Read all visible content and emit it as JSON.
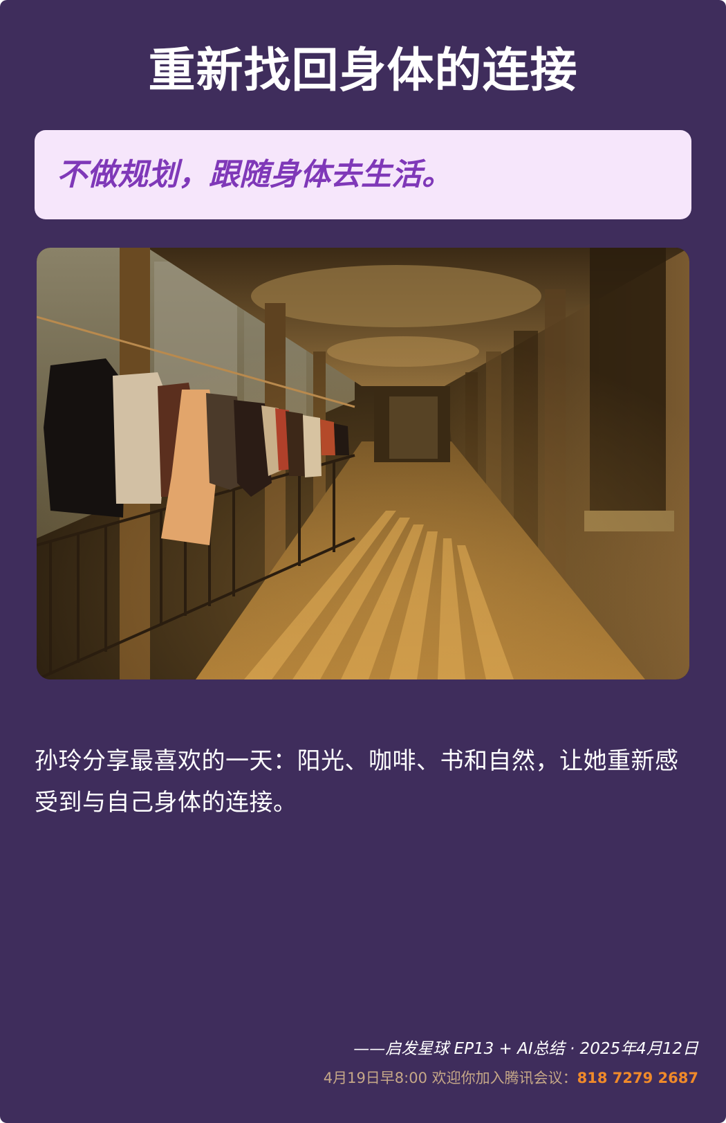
{
  "title": "重新找回身体的连接",
  "quote": "不做规划，跟随身体去生活。",
  "image": {
    "icon": "photo-corridor-with-hanging-clothes"
  },
  "body_text": "孙玲分享最喜欢的一天：阳光、咖啡、书和自然，让她重新感受到与自己身体的连接。",
  "footer": {
    "source": "——启发星球 EP13 + AI总结 · 2025年4月12日",
    "meeting_label": "4月19日早8:00 欢迎你加入腾讯会议：",
    "meeting_number": "818 7279 2687"
  },
  "colors": {
    "background": "#3f2d5c",
    "quote_box": "#f6e6fb",
    "quote_text": "#7f38b8",
    "meeting_number": "#f08a2a",
    "meeting_label": "#c6a888"
  }
}
